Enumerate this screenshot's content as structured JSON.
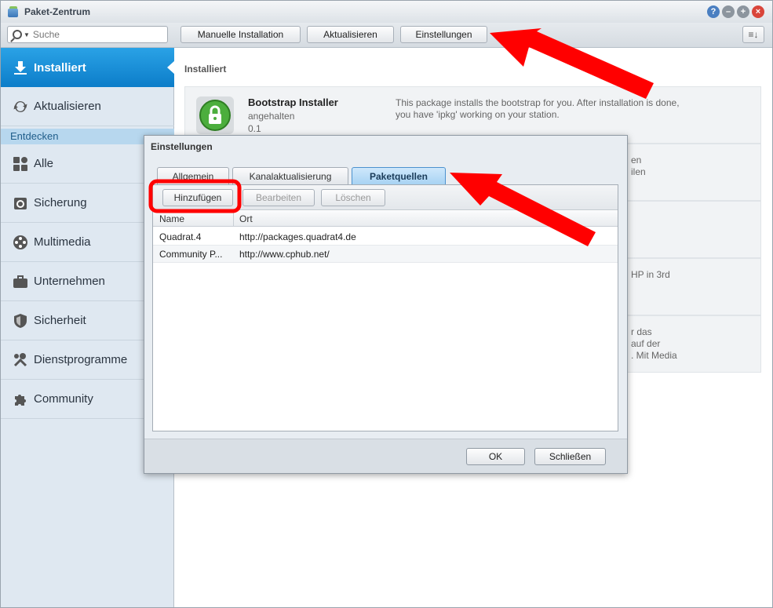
{
  "window": {
    "title": "Paket-Zentrum",
    "controls": [
      "?",
      "–",
      "+",
      "×"
    ]
  },
  "toolbar": {
    "search_placeholder": "Suche",
    "manual_install": "Manuelle Installation",
    "update": "Aktualisieren",
    "settings": "Einstellungen",
    "sort_icon": "≡↓"
  },
  "sidebar": {
    "installed": "Installiert",
    "updates": "Aktualisieren",
    "section": "Entdecken",
    "items": [
      {
        "label": "Alle",
        "icon": "grid-icon"
      },
      {
        "label": "Sicherung",
        "icon": "backup-icon"
      },
      {
        "label": "Multimedia",
        "icon": "film-reel-icon"
      },
      {
        "label": "Unternehmen",
        "icon": "briefcase-icon"
      },
      {
        "label": "Sicherheit",
        "icon": "shield-icon"
      },
      {
        "label": "Dienstprogramme",
        "icon": "tools-icon"
      },
      {
        "label": "Community",
        "icon": "puzzle-icon"
      }
    ]
  },
  "main": {
    "title": "Installiert",
    "packages": [
      {
        "name": "Bootstrap Installer",
        "status": "angehalten",
        "version": "0.1",
        "description": "This package installs the bootstrap for you. After installation is done, you have 'ipkg' working on your station."
      }
    ],
    "partial_desc": {
      "row2_a": "en",
      "row2_b": "ilen",
      "row4": "HP in 3rd",
      "row5_a": "r das",
      "row5_b": "auf der",
      "row5_c": ". Mit Media"
    }
  },
  "dialog": {
    "title": "Einstellungen",
    "tabs": [
      "Allgemein",
      "Kanalaktualisierung",
      "Paketquellen"
    ],
    "active_tab": "Paketquellen",
    "buttons": {
      "add": "Hinzufügen",
      "edit": "Bearbeiten",
      "delete": "Löschen"
    },
    "columns": {
      "name": "Name",
      "location": "Ort"
    },
    "sources": [
      {
        "name": "Quadrat.4",
        "url": "http://packages.quadrat4.de"
      },
      {
        "name": "Community P...",
        "url": "http://www.cphub.net/"
      }
    ],
    "ok": "OK",
    "close": "Schließen"
  },
  "colors": {
    "accent": "#0c7dc9",
    "annotation_red": "#ff0000"
  }
}
